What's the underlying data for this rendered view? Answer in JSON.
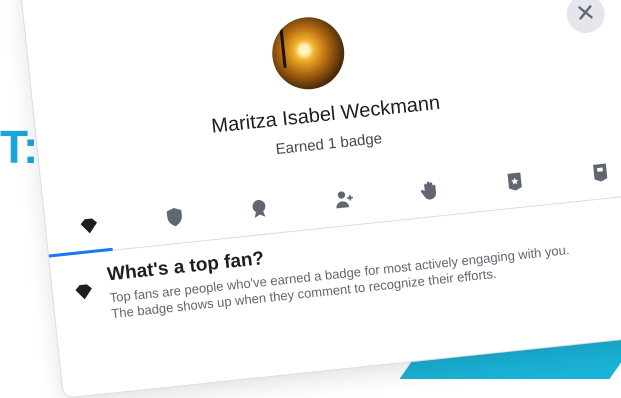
{
  "background": {
    "partial_heading": "T:"
  },
  "dialog": {
    "close_icon": "✕",
    "profile": {
      "name": "Maritza Isabel Weckmann",
      "subtitle": "Earned 1 badge"
    },
    "badges": [
      {
        "icon": "top-fan-icon",
        "active": true
      },
      {
        "icon": "shield-icon",
        "active": false
      },
      {
        "icon": "rising-fan-icon",
        "active": false
      },
      {
        "icon": "new-member-icon",
        "active": false
      },
      {
        "icon": "wave-icon",
        "active": false
      },
      {
        "icon": "visual-storyteller-icon",
        "active": false
      },
      {
        "icon": "conversation-starter-icon",
        "active": false
      }
    ],
    "info": {
      "title": "What's a top fan?",
      "line1": "Top fans are people who've earned a badge for most actively engaging with you.",
      "line2": "The badge shows up when they comment to recognize their efforts."
    }
  },
  "colors": {
    "accent": "#1877f2",
    "heading_blue": "#1aa6d8",
    "teal_shape": "#1ab2d6"
  }
}
